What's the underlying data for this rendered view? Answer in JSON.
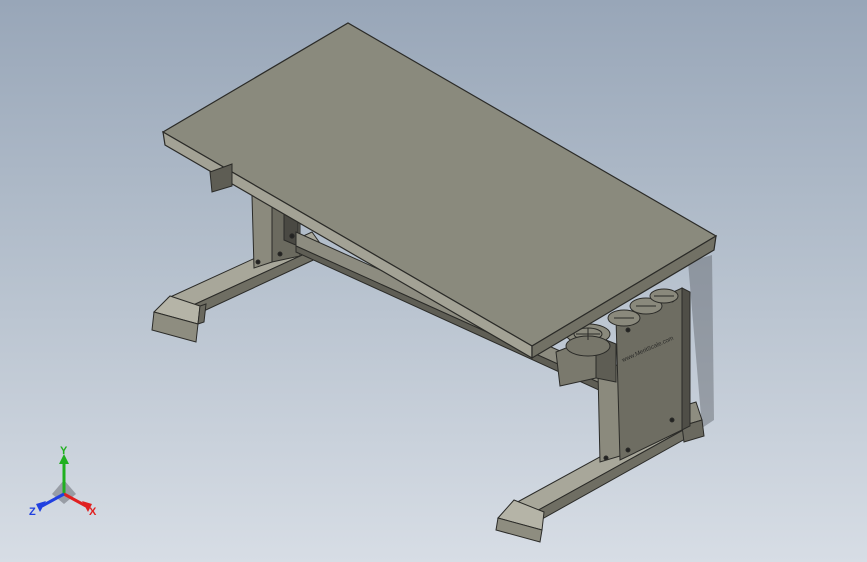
{
  "app": {
    "view": "isometric-3d-model-viewport"
  },
  "model": {
    "name": "height-adjustable-workbench",
    "parts": [
      "table-top",
      "left-leg-column",
      "left-foot",
      "right-leg-column",
      "right-foot",
      "cross-beam",
      "control-box",
      "crank-handwheels"
    ],
    "label_text": "www.MeritScale.com"
  },
  "triad": {
    "x_label": "X",
    "y_label": "Y",
    "z_label": "Z"
  },
  "colors": {
    "background_top": "#98a6b8",
    "background_bottom": "#d7dde5",
    "part_light": "#9c9b8e",
    "part_mid": "#828173",
    "part_dark": "#5d5c52",
    "edge": "#2b2b28",
    "axis_x": "#e02020",
    "axis_y": "#20b020",
    "axis_z": "#2040e0"
  }
}
